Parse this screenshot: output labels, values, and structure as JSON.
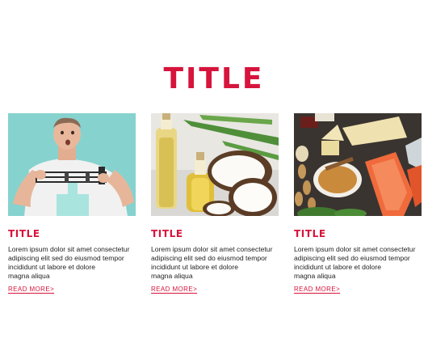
{
  "header": {
    "title": "TITLE"
  },
  "cards": [
    {
      "title": "TITLE",
      "body": "Lorem ipsum dolor sit amet consectetur\nadipiscing elit sed do eiusmod tempor\nincididunt ut labore et dolore\nmagna aliqua",
      "link_label": "READ MORE",
      "link_arrow": ">",
      "image": "man-on-weight-scale"
    },
    {
      "title": "TITLE",
      "body": "Lorem ipsum dolor sit amet consectetur\nadipiscing elit sed do eiusmod tempor\nincididunt ut labore et dolore\nmagna aliqua",
      "link_label": "READ MORE",
      "link_arrow": ">",
      "image": "coconut-oil-bottles"
    },
    {
      "title": "TITLE",
      "body": "Lorem ipsum dolor sit amet consectetur\nadipiscing elit sed do eiusmod tempor\nincididunt ut labore et dolore\nmagna aliqua",
      "link_label": "READ MORE",
      "link_arrow": ">",
      "image": "healthy-fats-food-spread"
    }
  ],
  "colors": {
    "accent": "#d7143c",
    "text": "#1f1f1f",
    "background": "#ffffff"
  }
}
